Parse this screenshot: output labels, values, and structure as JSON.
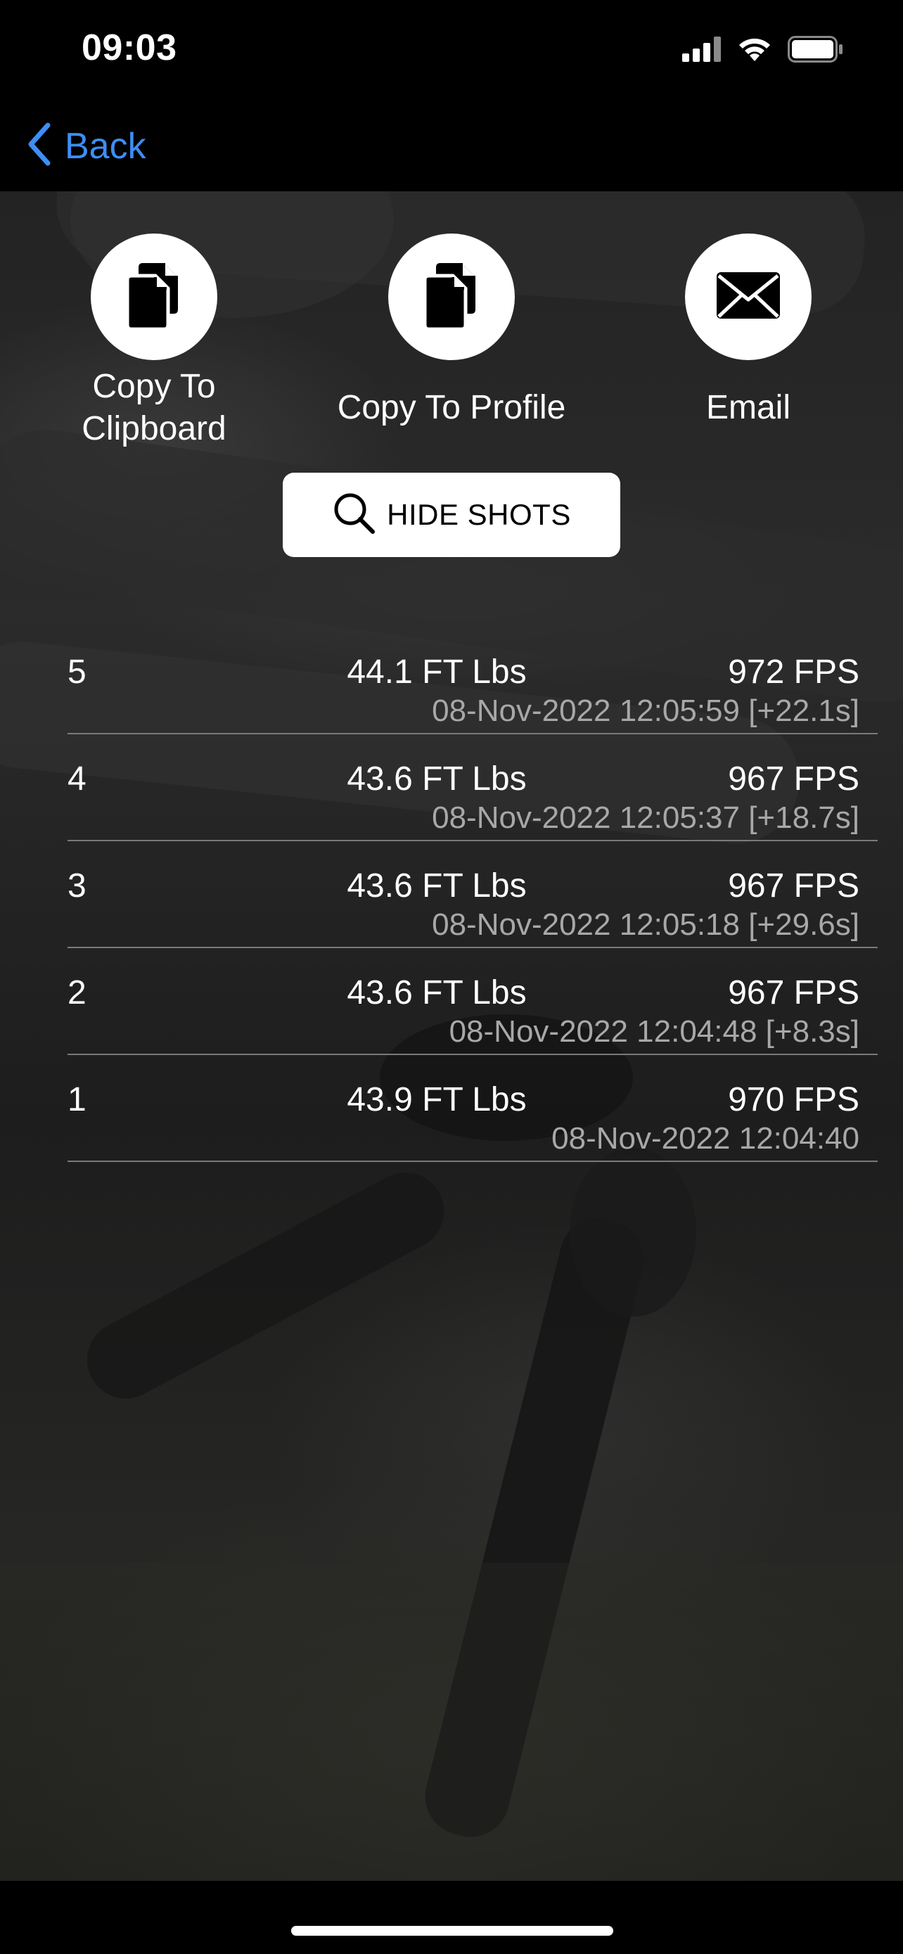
{
  "status_bar": {
    "time": "09:03"
  },
  "nav": {
    "back_label": "Back",
    "accent_color": "#3d8ef5"
  },
  "actions": {
    "copy_clipboard": {
      "label_line1": "Copy To",
      "label_line2": "Clipboard",
      "icon": "copy-document-icon"
    },
    "copy_profile": {
      "label": "Copy To Profile",
      "icon": "copy-document-icon"
    },
    "email": {
      "label": "Email",
      "icon": "envelope-icon"
    }
  },
  "hide_shots": {
    "label": "HIDE SHOTS",
    "icon": "search-icon"
  },
  "shots": [
    {
      "number": "5",
      "energy": "44.1 FT Lbs",
      "fps": "972 FPS",
      "timestamp": "08-Nov-2022 12:05:59 [+22.1s]"
    },
    {
      "number": "4",
      "energy": "43.6 FT Lbs",
      "fps": "967 FPS",
      "timestamp": "08-Nov-2022 12:05:37 [+18.7s]"
    },
    {
      "number": "3",
      "energy": "43.6 FT Lbs",
      "fps": "967 FPS",
      "timestamp": "08-Nov-2022 12:05:18 [+29.6s]"
    },
    {
      "number": "2",
      "energy": "43.6 FT Lbs",
      "fps": "967 FPS",
      "timestamp": "08-Nov-2022 12:04:48 [+8.3s]"
    },
    {
      "number": "1",
      "energy": "43.9 FT Lbs",
      "fps": "970 FPS",
      "timestamp": "08-Nov-2022 12:04:40"
    }
  ]
}
